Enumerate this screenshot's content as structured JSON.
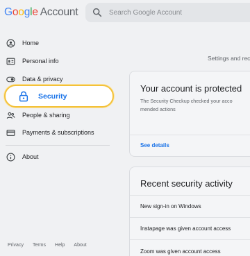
{
  "header": {
    "logo_google": "Google",
    "logo_account": "Account",
    "search_placeholder": "Search Google Account"
  },
  "sidebar": {
    "items": [
      {
        "label": "Home",
        "icon": "home-icon"
      },
      {
        "label": "Personal info",
        "icon": "id-card-icon"
      },
      {
        "label": "Data & privacy",
        "icon": "toggle-icon"
      },
      {
        "label": "Security",
        "icon": "lock-icon",
        "active": true
      },
      {
        "label": "People & sharing",
        "icon": "people-icon"
      },
      {
        "label": "Payments & subscriptions",
        "icon": "credit-card-icon"
      },
      {
        "label": "About",
        "icon": "info-icon"
      }
    ],
    "footer_links": [
      "Privacy",
      "Terms",
      "Help",
      "About"
    ]
  },
  "main": {
    "settings_text": "Settings and rec",
    "protected_card": {
      "title": "Your account is protected",
      "description_line1": "The Security Checkup checked your acco",
      "description_line2": "mended actions",
      "link": "See details"
    },
    "activity_card": {
      "title": "Recent security activity",
      "items": [
        "New sign-in on Windows",
        "Instapage was given account access",
        "Zoom was given account access"
      ]
    }
  },
  "colors": {
    "accent": "#1a73e8",
    "highlight_border": "#f3c13a",
    "background": "#f0f1f3"
  }
}
